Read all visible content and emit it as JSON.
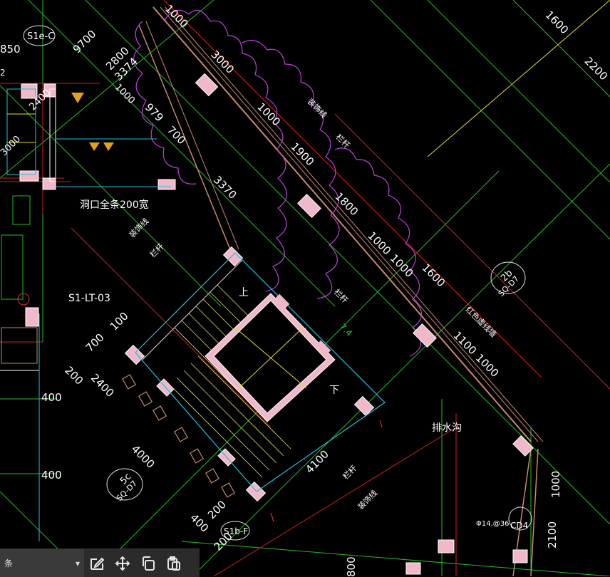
{
  "labels": {
    "tag_s1e_c": "S1e-C",
    "tag_s1b_f": "S1b-F",
    "tag_2b_top": "2b",
    "tag_2b_bottom": "SQ-D7",
    "tag_5c_top": "5c",
    "tag_5c_bottom": "SQ-D7",
    "tag_cd4": "CD4",
    "stair_id": "S1-LT-03",
    "hole_note": "洞口全条200宽",
    "drain": "排水沟",
    "up": "上",
    "down": "下",
    "elev_74": "7.4",
    "dia_note": "Φ14.@36",
    "rail_1": "栏杆",
    "rail_2": "栏杆",
    "rail_3": "栏杆",
    "rail_4": "栏杆",
    "line_1": "装饰线",
    "line_2": "装饰线",
    "line_3": "装饰线",
    "wall_note": "红色虚线墙",
    "left_3": "2"
  },
  "dims": {
    "d1000a": "1000",
    "d1600": "1600",
    "d2200": "2200",
    "d9700": "9700",
    "d2800": "2800",
    "d3374": "3374",
    "d850": "850",
    "d3000": "3000",
    "d1000b": "1000",
    "d979": "979",
    "d700a": "700",
    "d1900": "1900",
    "d3370": "3370",
    "d1800": "1800",
    "d1000c": "1000",
    "d1000d": "1000",
    "d1600b": "1600",
    "d1100": "1100",
    "d1000e": "1000",
    "d700b": "700",
    "d100": "100",
    "d200a": "200",
    "d2400": "2400",
    "d400a": "400",
    "d400b": "400",
    "d4000": "4000",
    "d4100": "4100",
    "d400c": "400",
    "d200b": "200",
    "d200c": "200",
    "d1000f": "1000",
    "d2100": "2100",
    "d800": "800",
    "d2400b": "2400",
    "d1000g": "1000",
    "d3000b": "3000"
  },
  "toolbar": {
    "command_text": "条",
    "edit_icon": "edit-icon",
    "move_icon": "move-icon",
    "copy_icon": "copy-icon",
    "paste_icon": "paste-icon"
  }
}
